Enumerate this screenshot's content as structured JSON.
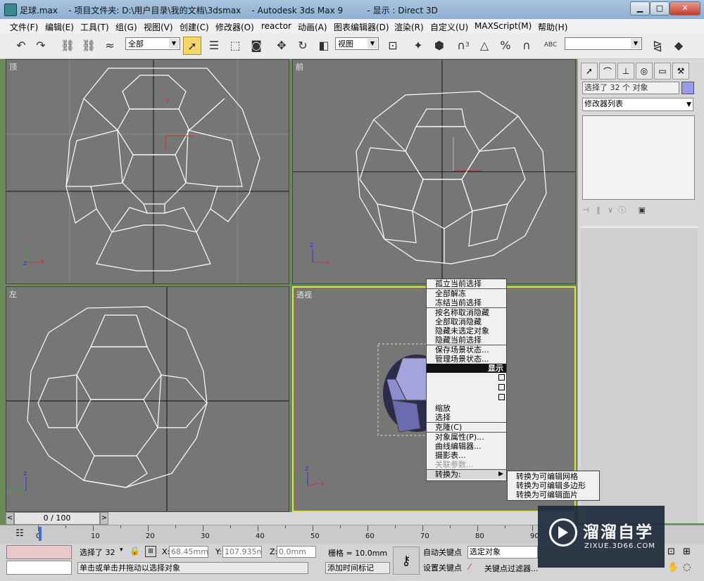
{
  "window": {
    "title": "足球.max    - 项目文件夹: D:\\用户目录\\我的文档\\3dsmax    - Autodesk 3ds Max 9         - 显示 : Direct 3D",
    "minimize": "▁",
    "maximize": "□",
    "close": "✕"
  },
  "menu": [
    "文件(F)",
    "编辑(E)",
    "工具(T)",
    "组(G)",
    "视图(V)",
    "创建(C)",
    "修改器(O)",
    "reactor",
    "动画(A)",
    "图表编辑器(D)",
    "渲染(R)",
    "自定义(U)",
    "MAXScript(M)",
    "帮助(H)"
  ],
  "toolbar": {
    "selection_filter": "全部",
    "ref_coord": "视图",
    "named_selection": "",
    "snap_label": "3",
    "abc_label": "ABC"
  },
  "viewports": {
    "top": "顶",
    "front": "前",
    "left": "左",
    "perspective": "透视"
  },
  "axis": {
    "x": "x",
    "y": "y",
    "z": "z"
  },
  "command_panel": {
    "selection_status": "选择了 32 个 对象",
    "modifier_list": "修改器列表"
  },
  "quad_menu": {
    "top_items": [
      "孤立当前选择",
      "全部解冻",
      "冻结当前选择",
      "按名称取消隐藏",
      "全部取消隐藏",
      "隐藏未选定对象",
      "隐藏当前选择",
      "保存场景状态...",
      "管理场景状态..."
    ],
    "display_header": "显示",
    "transform_items": [
      "缩放",
      "选择",
      "克隆(C)",
      "对象属性(P)...",
      "曲线编辑器...",
      "摄影表...",
      "关联参数...",
      "转换为:"
    ],
    "submenu": [
      "转换为可编辑网格",
      "转换为可编辑多边形",
      "转换为可编辑面片"
    ]
  },
  "timeline": {
    "frame": "0 / 100",
    "ticks": [
      "0",
      "10",
      "20",
      "30",
      "40",
      "50",
      "60",
      "70",
      "80",
      "90"
    ]
  },
  "status": {
    "selected": "选择了 32",
    "x_label": "X:",
    "x_value": "68.45mm",
    "y_label": "Y:",
    "y_value": "107.935mm",
    "z_label": "Z:",
    "z_value": "0.0mm",
    "grid": "栅格 = 10.0mm",
    "prompt": "单击或单击并拖动以选择对象",
    "add_time_tag": "添加时间标记",
    "auto_key": "自动关键点",
    "set_key": "设置关键点",
    "key_mode": "选定对象",
    "key_filters": "关键点过滤器..."
  },
  "watermark": {
    "brand": "溜溜自学",
    "url": "ZIXUE.3D66.COM"
  }
}
